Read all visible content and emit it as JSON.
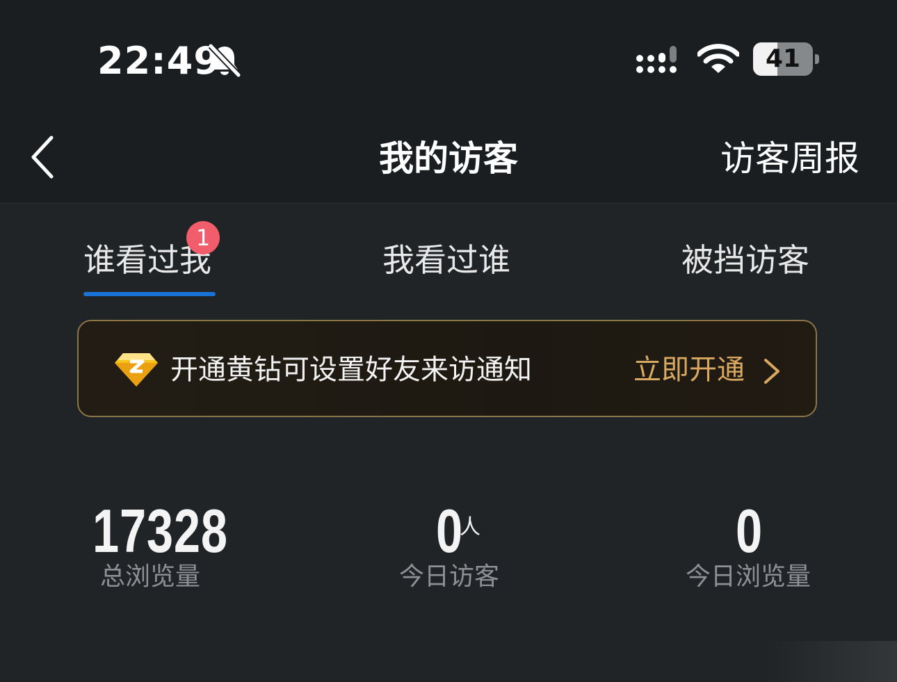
{
  "status_bar": {
    "time": "22:49",
    "battery_level": "41",
    "battery_fraction": 0.41,
    "icons": [
      "bell-slash-icon",
      "signal-icon",
      "wifi-icon",
      "battery-icon"
    ]
  },
  "nav": {
    "back_icon": "chevron-left-icon",
    "title": "我的访客",
    "right_action": "访客周报"
  },
  "tabs": [
    {
      "label": "谁看过我",
      "badge": "1",
      "active": true
    },
    {
      "label": "我看过谁"
    },
    {
      "label": "被挡访客"
    }
  ],
  "banner": {
    "icon": "yellow-diamond-icon",
    "text": "开通黄钻可设置好友来访通知",
    "action": "立即开通",
    "action_icon": "chevron-right-icon"
  },
  "stats": [
    {
      "value": "17328",
      "label": "总浏览量"
    },
    {
      "value": "0",
      "unit": "人",
      "label": "今日访客"
    },
    {
      "value": "0",
      "label": "今日浏览量"
    }
  ],
  "colors": {
    "background": "#212427",
    "header": "#1b1e21",
    "accent": "#1a72d6",
    "badge": "#f25d6b",
    "gold": "#d9a861",
    "muted": "#8d9196"
  }
}
